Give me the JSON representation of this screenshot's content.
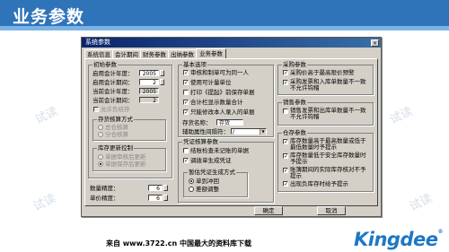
{
  "slide": {
    "title": "业务参数",
    "watermark": "试读",
    "footer": "来自 www.3722.cn 中国最大的资料库下载",
    "logo": "Kingdee"
  },
  "dialog": {
    "title": "系统参数",
    "close_glyph": "×",
    "tabs": [
      "系统信息",
      "会计期间",
      "财务参数",
      "出纳参数",
      "业务参数"
    ],
    "active_tab": "业务参数",
    "initial_group": {
      "label": "初始参数",
      "start_year_label": "启用会计年度：",
      "start_year": "2005",
      "start_period_label": "启用会计期间：",
      "start_period": "2",
      "current_year_label": "当前会计年度：",
      "current_year": "2005",
      "current_period_label": "当前会计期间：",
      "current_period": "2",
      "allow_negative_label": "允许负结存"
    },
    "costing_group": {
      "label": "存货核算方式",
      "options": [
        "总仓核算",
        "分仓核算"
      ]
    },
    "inventory_control_group": {
      "label": "库存更新控制",
      "options": [
        "单据审核后更新",
        "单据保存后更新"
      ]
    },
    "qty_decimal_label": "数量精度：",
    "qty_decimal": "6",
    "price_decimal_label": "单价精度：",
    "price_decimal": "6",
    "basic_group": {
      "label": "基本选项",
      "checks": [
        "审核和制单可为同一人",
        "使用可计量单位",
        "打印《提起》前保存单据",
        "合计栏显示数量合计",
        "只能修改本人录入的单据"
      ],
      "checked": [
        true,
        true,
        false,
        true,
        true
      ],
      "store_name_label": "存货名称：",
      "store_name_value": "存货",
      "aux_attr_label": "辅助属性间隔符：",
      "aux_attr_value": "/"
    },
    "voucher_group": {
      "label": "凭证核算参数",
      "checks": [
        "结账检查未记账的单据",
        "调拨单生成凭证"
      ],
      "checked": [
        false,
        true
      ],
      "sub_group_label": "暂估凭证生成方式",
      "sub_options": [
        "单到冲回",
        "差额调整"
      ]
    },
    "purchase_group": {
      "label": "采购参数",
      "checks": [
        "采购价高于最高限价预警",
        "采购发票和入库单数量不一致不允许钩稽"
      ],
      "checked": [
        true,
        true
      ]
    },
    "sales_group": {
      "label": "销售参数",
      "checks": [
        "销售发票和出库单数量不一致不允许钩稽"
      ],
      "checked": [
        false
      ]
    },
    "warehouse_group": {
      "label": "仓存参数",
      "checks": [
        "库存数量高于最高数量或低于最低数量时予提示",
        "库存数量低于安全库存数量时予提示",
        "账簿期间的实际库存核对不予提示",
        "出现负库存时给予提示"
      ],
      "checked": [
        true,
        true,
        true,
        true
      ]
    },
    "buttons": {
      "ok": "确定",
      "cancel": "取消"
    }
  }
}
